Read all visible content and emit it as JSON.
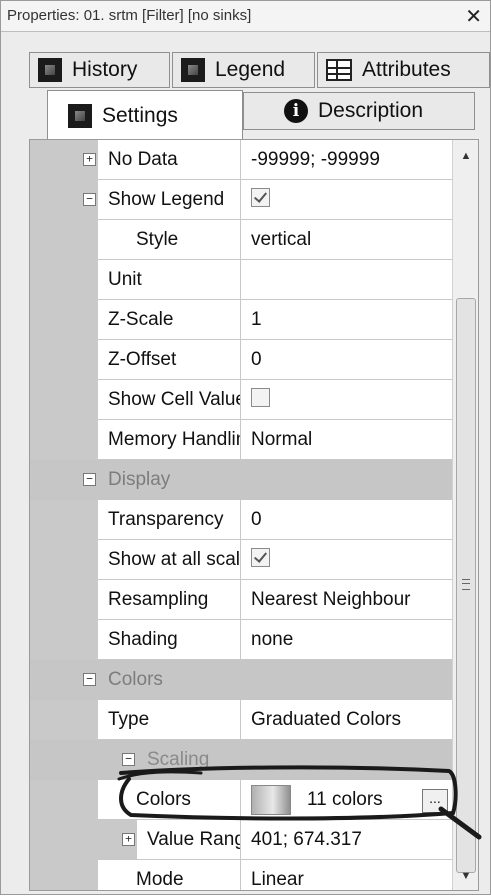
{
  "window": {
    "title": "Properties: 01. srtm [Filter] [no sinks]",
    "close_glyph": "✕"
  },
  "tabs": {
    "history": "History",
    "legend": "Legend",
    "attributes": "Attributes",
    "settings": "Settings",
    "description": "Description"
  },
  "properties": {
    "no_data": {
      "name": "No Data",
      "value": "-99999; -99999"
    },
    "show_legend": {
      "name": "Show Legend",
      "checked": true
    },
    "style": {
      "name": "Style",
      "value": "vertical"
    },
    "unit": {
      "name": "Unit",
      "value": ""
    },
    "z_scale": {
      "name": "Z-Scale",
      "value": "1"
    },
    "z_offset": {
      "name": "Z-Offset",
      "value": "0"
    },
    "show_cell_values": {
      "name": "Show Cell Values",
      "checked": false
    },
    "memory_handling": {
      "name": "Memory Handling",
      "value": "Normal"
    },
    "display_category": "Display",
    "transparency": {
      "name": "Transparency",
      "value": "0"
    },
    "show_at_all_scales": {
      "name": "Show at all scales",
      "checked": true
    },
    "resampling": {
      "name": "Resampling",
      "value": "Nearest Neighbour"
    },
    "shading": {
      "name": "Shading",
      "value": "none"
    },
    "colors_category": "Colors",
    "type": {
      "name": "Type",
      "value": "Graduated Colors"
    },
    "scaling_category": "Scaling",
    "colors": {
      "name": "Colors",
      "value": "11 colors",
      "button": "..."
    },
    "value_range": {
      "name": "Value Range",
      "value": "401; 674.317"
    },
    "mode": {
      "name": "Mode",
      "value": "Linear"
    }
  },
  "icons": {
    "history": "layer-square-icon",
    "legend": "layer-square-icon",
    "attributes": "table-grid-icon",
    "settings": "layer-square-icon",
    "description": "info-icon"
  },
  "colors": {
    "gutter": "#c9c9c9",
    "category_row": "#c6c6c6",
    "annotation_ink": "#1a1a1a"
  }
}
